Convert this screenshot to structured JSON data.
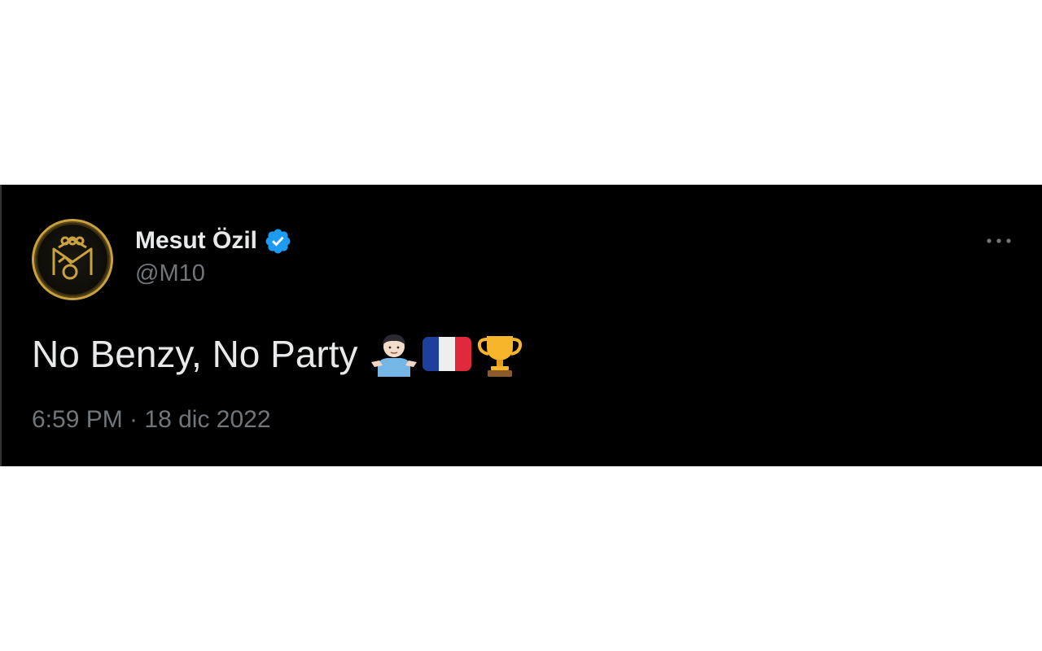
{
  "tweet": {
    "author": {
      "display_name": "Mesut Özil",
      "handle": "@M10",
      "verified": true,
      "avatar_icon": "m10-logo-icon"
    },
    "text": "No Benzy, No Party",
    "emojis": [
      "person-shrugging-emoji",
      "france-flag-emoji",
      "trophy-emoji"
    ],
    "timestamp": "6:59 PM · 18 dic 2022",
    "more_icon": "more-options-icon"
  },
  "colors": {
    "card_background": "#000000",
    "primary_text": "#e7e9ea",
    "secondary_text": "#71767b",
    "verified_badge": "#1d9bf0",
    "avatar_gold": "#c9a23f",
    "page_background": "#ffffff"
  }
}
